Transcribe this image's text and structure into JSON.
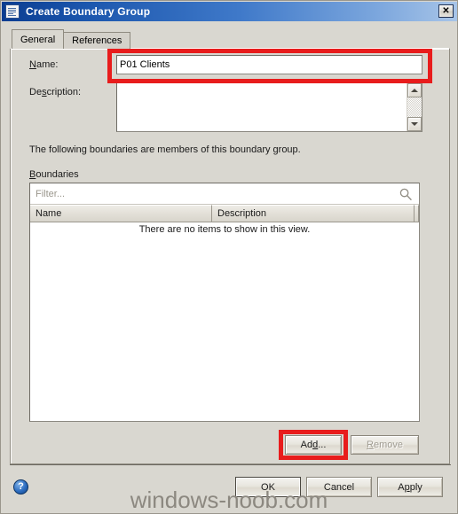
{
  "window": {
    "title": "Create Boundary Group",
    "icon": "window-document-icon",
    "close_label": "✕",
    "titlebar_gradient_start": "#0b3d91",
    "titlebar_gradient_end": "#a8c5e8"
  },
  "tabs": [
    {
      "label": "General",
      "active": true
    },
    {
      "label": "References",
      "active": false
    }
  ],
  "general": {
    "name": {
      "label_pre": "",
      "label_accel": "N",
      "label_post": "ame:",
      "value": "P01 Clients",
      "placeholder": "",
      "highlighted": true,
      "highlight_color": "#e81c1c"
    },
    "description": {
      "label_pre": "De",
      "label_accel": "s",
      "label_post": "cription:",
      "value": "",
      "placeholder": "",
      "scroll_up_icon": "scroll-up-arrow-icon",
      "scroll_down_icon": "scroll-down-arrow-icon"
    },
    "info_text": "The following boundaries are members of this boundary group.",
    "boundaries_label_accel": "B",
    "boundaries_label_rest": "oundaries",
    "filter": {
      "placeholder": "Filter...",
      "value": "",
      "icon": "search-icon"
    },
    "list": {
      "columns": [
        "Name",
        "Description"
      ],
      "rows": [],
      "empty_message": "There are no items to show in this view."
    },
    "add_button": {
      "pre": "Ad",
      "accel": "d",
      "post": "...",
      "enabled": true,
      "highlighted": true,
      "highlight_color": "#e81c1c"
    },
    "remove_button": {
      "pre": "",
      "accel": "R",
      "post": "emove",
      "enabled": false
    }
  },
  "footer": {
    "help_icon": "help-question-icon",
    "help_glyph": "?",
    "buttons": [
      {
        "pre": "OK",
        "accel": "",
        "post": "",
        "default": true
      },
      {
        "pre": "Cancel",
        "accel": "",
        "post": "",
        "default": false
      },
      {
        "pre": "A",
        "accel": "p",
        "post": "ply",
        "default": false
      }
    ]
  },
  "watermark": "windows-noob.com"
}
